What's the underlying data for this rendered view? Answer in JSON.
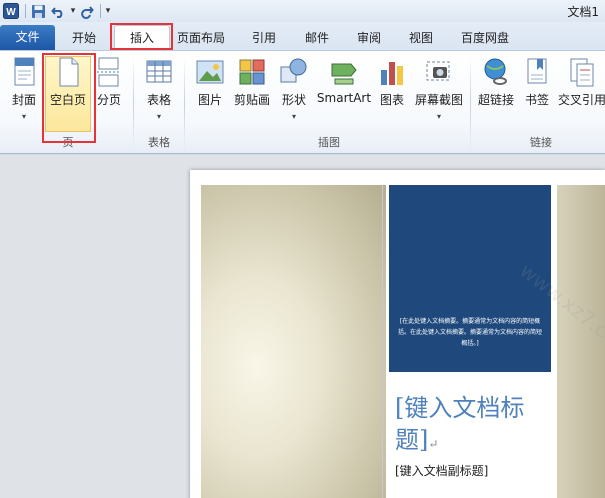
{
  "titlebar": {
    "app_icon_label": "W",
    "doc_title": "文档1",
    "qat_dropdown": "▾",
    "qat_customize": "▾"
  },
  "tabs": [
    {
      "label": "文件"
    },
    {
      "label": "开始"
    },
    {
      "label": "插入"
    },
    {
      "label": "页面布局"
    },
    {
      "label": "引用"
    },
    {
      "label": "邮件"
    },
    {
      "label": "审阅"
    },
    {
      "label": "视图"
    },
    {
      "label": "百度网盘"
    }
  ],
  "ribbon": {
    "groups": {
      "pages": "页",
      "table": "表格",
      "illustrations": "插图",
      "links": "链接"
    },
    "buttons": {
      "cover": "封面",
      "blank": "空白页",
      "page_break": "分页",
      "table": "表格",
      "picture": "图片",
      "clipart": "剪贴画",
      "shapes": "形状",
      "smartart": "SmartArt",
      "chart": "图表",
      "screenshot": "屏幕截图",
      "hyperlink": "超链接",
      "bookmark": "书签",
      "cross_ref": "交叉引用"
    },
    "dropdown_arrow": "▾"
  },
  "document": {
    "abstract_text": "[在此处键入文档摘要。摘要通常为文档内容的简短概括。在此处键入文档摘要。摘要通常为文档内容的简短概括。]",
    "title_placeholder": "[键入文档标题]",
    "paragraph_mark": "↵",
    "subtitle_placeholder": "[键入文档副标题]",
    "watermark": "www.xz7.com"
  },
  "colors": {
    "file_tab": "#1d57a5",
    "highlight": "#e63239",
    "blue_box": "#1f497d",
    "title_text": "#4f81bd"
  }
}
